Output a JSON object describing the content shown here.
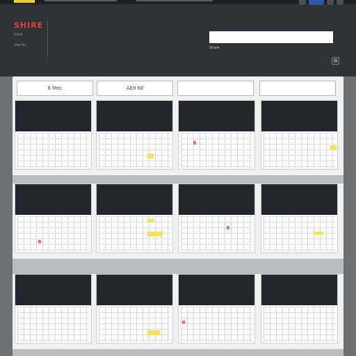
{
  "app": {
    "logo": "SHIRE",
    "logo_sub": "Sched",
    "logo_sub2": "Sean Ter"
  },
  "header": {
    "description": "",
    "search_placeholder": "",
    "search_meta_text": "",
    "search_meta_link": "",
    "search_meta_end": "Share"
  },
  "tabs": [
    {
      "label": "6 Mec",
      "active": false
    },
    {
      "label": "AE9 6E",
      "active": false
    },
    {
      "label": "",
      "active": false
    },
    {
      "label": "",
      "active": true
    }
  ],
  "colors": {
    "accent": "#e8d23a",
    "logo": "#e0443a",
    "active_tab": "#a08a1a",
    "card_header": "#23272d",
    "highlight_yellow": "#efe55a",
    "highlight_pink": "#e8708a"
  },
  "rows": [
    {
      "cards": [
        {
          "title": "",
          "sub": ""
        },
        {
          "title": "",
          "sub": ""
        },
        {
          "title": "",
          "sub": ""
        },
        {
          "title": "",
          "sub": ""
        }
      ]
    },
    {
      "cards": [
        {
          "title": "",
          "sub": ""
        },
        {
          "title": "",
          "sub": ""
        },
        {
          "title": "",
          "sub": ""
        },
        {
          "title": "",
          "sub": ""
        }
      ]
    },
    {
      "cards": [
        {
          "title": "",
          "sub": ""
        },
        {
          "title": "",
          "sub": ""
        },
        {
          "title": "",
          "sub": ""
        },
        {
          "title": "",
          "sub": ""
        }
      ]
    }
  ],
  "icons": [
    "calendar-icon",
    "grid-icon",
    "settings-icon"
  ]
}
